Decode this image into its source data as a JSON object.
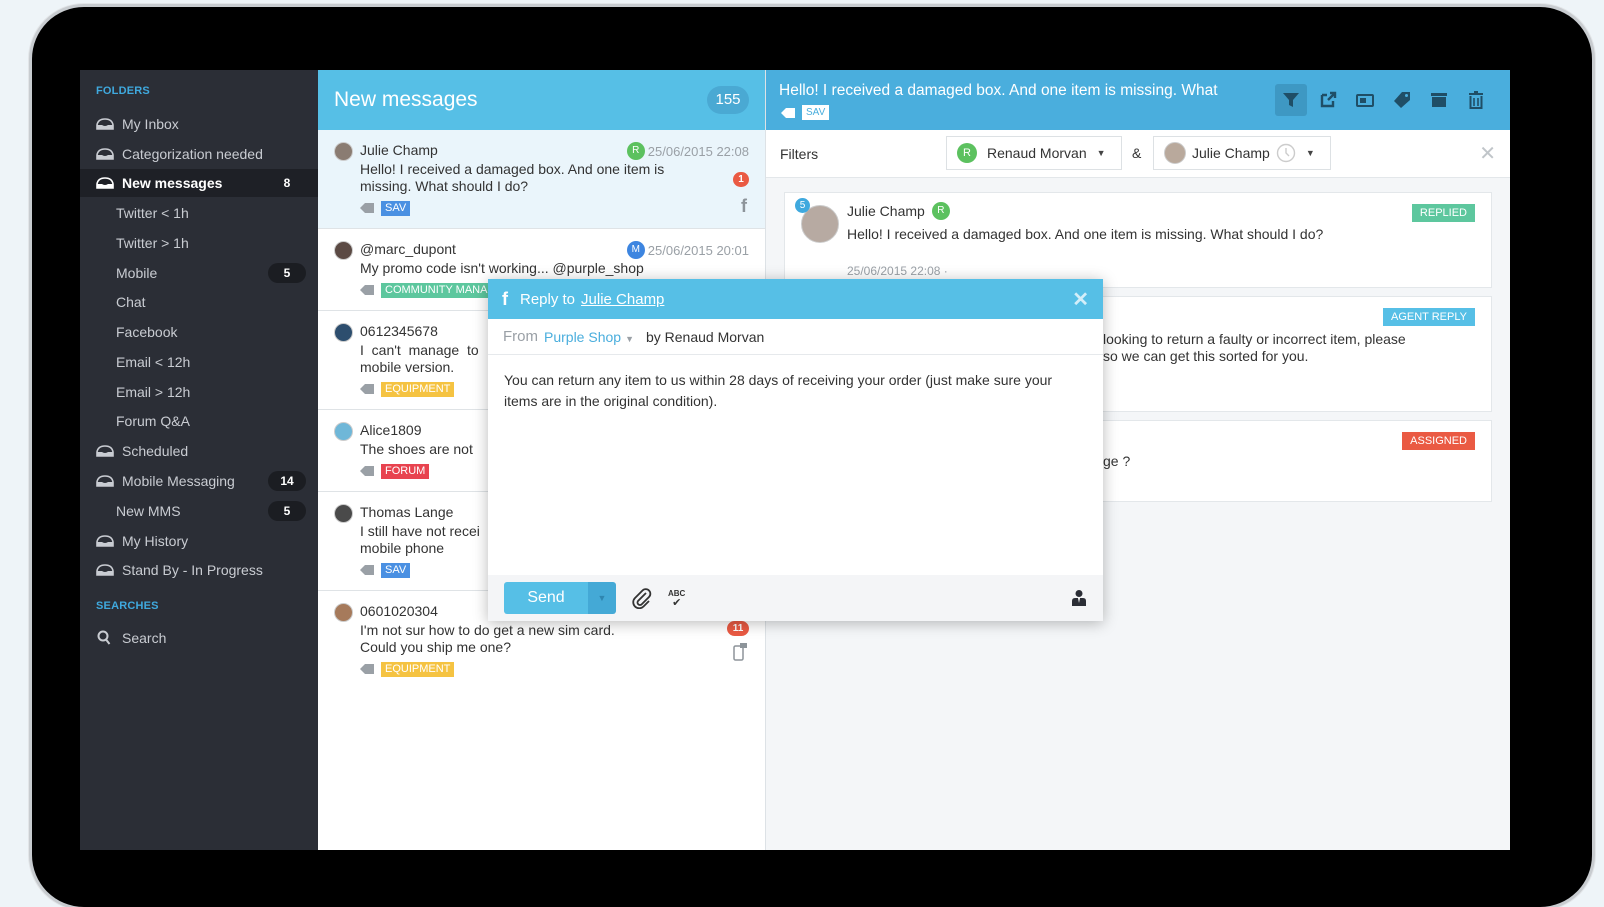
{
  "sidebar": {
    "folders_title": "FOLDERS",
    "searches_title": "SEARCHES",
    "items": [
      {
        "label": "My Inbox",
        "icon": "inbox-icon",
        "type": "folder",
        "count": ""
      },
      {
        "label": "Categorization needed",
        "icon": "inbox-icon",
        "type": "folder",
        "count": ""
      },
      {
        "label": "New messages",
        "icon": "inbox-icon",
        "type": "folder",
        "count": "8",
        "active": true
      },
      {
        "label": "Twitter < 1h",
        "type": "sub",
        "count": ""
      },
      {
        "label": "Twitter > 1h",
        "type": "sub",
        "count": ""
      },
      {
        "label": "Mobile",
        "type": "sub",
        "count": "5"
      },
      {
        "label": "Chat",
        "type": "sub",
        "count": ""
      },
      {
        "label": "Facebook",
        "type": "sub",
        "count": ""
      },
      {
        "label": "Email < 12h",
        "type": "sub",
        "count": ""
      },
      {
        "label": "Email > 12h",
        "type": "sub",
        "count": ""
      },
      {
        "label": "Forum Q&A",
        "type": "sub",
        "count": ""
      },
      {
        "label": "Scheduled",
        "icon": "inbox-icon",
        "type": "folder",
        "count": ""
      },
      {
        "label": "Mobile Messaging",
        "icon": "inbox-icon",
        "type": "folder",
        "count": "14"
      },
      {
        "label": "New MMS",
        "type": "sub",
        "count": "5"
      },
      {
        "label": "My History",
        "icon": "inbox-icon",
        "type": "folder",
        "count": ""
      },
      {
        "label": "Stand By - In Progress",
        "icon": "inbox-icon",
        "type": "folder",
        "count": ""
      }
    ],
    "search_label": "Search"
  },
  "list": {
    "title": "New messages",
    "count": "155",
    "messages": [
      {
        "sender": "Julie Champ",
        "agent": "R",
        "agent_color": "#5cc15f",
        "date": "25/06/2015 22:08",
        "body": "Hello! I received a damaged box. And one item is missing. What should I do?",
        "tag": "SAV",
        "tag_color": "#4a90e2",
        "unread": "1",
        "channel": "facebook-icon"
      },
      {
        "sender": "@marc_dupont",
        "agent": "M",
        "agent_color": "#3d85e0",
        "date": "25/06/2015 20:01",
        "body": "My promo code isn't working... @purple_shop",
        "tag": "COMMUNITY MANAGEMENT",
        "tag_color": "#5dc79e"
      },
      {
        "sender": "0612345678",
        "body": "I can't manage to connect to the mobile version.",
        "body_visible": "I  can't  manage  to",
        "body_line2": "mobile version.",
        "tag": "EQUIPMENT",
        "tag_color": "#f5c342"
      },
      {
        "sender": "Alice1809",
        "body": "The shoes are not",
        "tag": "FORUM",
        "tag_color": "#e8434f"
      },
      {
        "sender": "Thomas Lange",
        "body": "I still have not recei",
        "body_line2": "mobile phone",
        "tag": "SAV",
        "tag_color": "#4a90e2"
      },
      {
        "sender": "0601020304",
        "body": "I'm not sur how to do get a new sim card.",
        "body_line2": "Could you ship me one?",
        "tag": "EQUIPMENT",
        "tag_color": "#f5c342",
        "unread": "11",
        "channel": "mobile-icon"
      }
    ]
  },
  "detail": {
    "subject": "Hello! I received a damaged box. And one item is missing. What",
    "tag": "SAV",
    "toolbar": [
      "filter-icon",
      "external-link-icon",
      "newspaper-icon",
      "tag-icon",
      "archive-icon",
      "trash-icon"
    ],
    "filters_label": "Filters",
    "filter_agent": {
      "initial": "R",
      "name": "Renaud Morvan"
    },
    "amp": "&",
    "filter_contact": {
      "name": "Julie Champ"
    },
    "cards": [
      {
        "sender": "Julie Champ",
        "agent": "R",
        "badge": "5",
        "text": "Hello! I received a damaged box. And one item is missing. What should I do?",
        "time": "25/06/2015 22:08 ·",
        "status": "REPLIED",
        "status_color": "#5dc79e"
      },
      {
        "text1": "looking to return a faulty or incorrect item, please",
        "text2": "so we can get this sorted for you.",
        "status": "AGENT REPLY",
        "status_color": "#56bfe6"
      },
      {
        "text1": "ge ?",
        "status": "ASSIGNED",
        "status_color": "#ea5a43"
      }
    ]
  },
  "reply": {
    "reply_to_label": "Reply to",
    "recipient": "Julie Champ",
    "from_label": "From",
    "from_value": "Purple Shop",
    "by": "by Renaud Morvan",
    "body": "You can return any item to us within 28 days of receiving your order (just make sure your items are in the original condition).",
    "send_label": "Send",
    "spellcheck_label": "ABC"
  }
}
